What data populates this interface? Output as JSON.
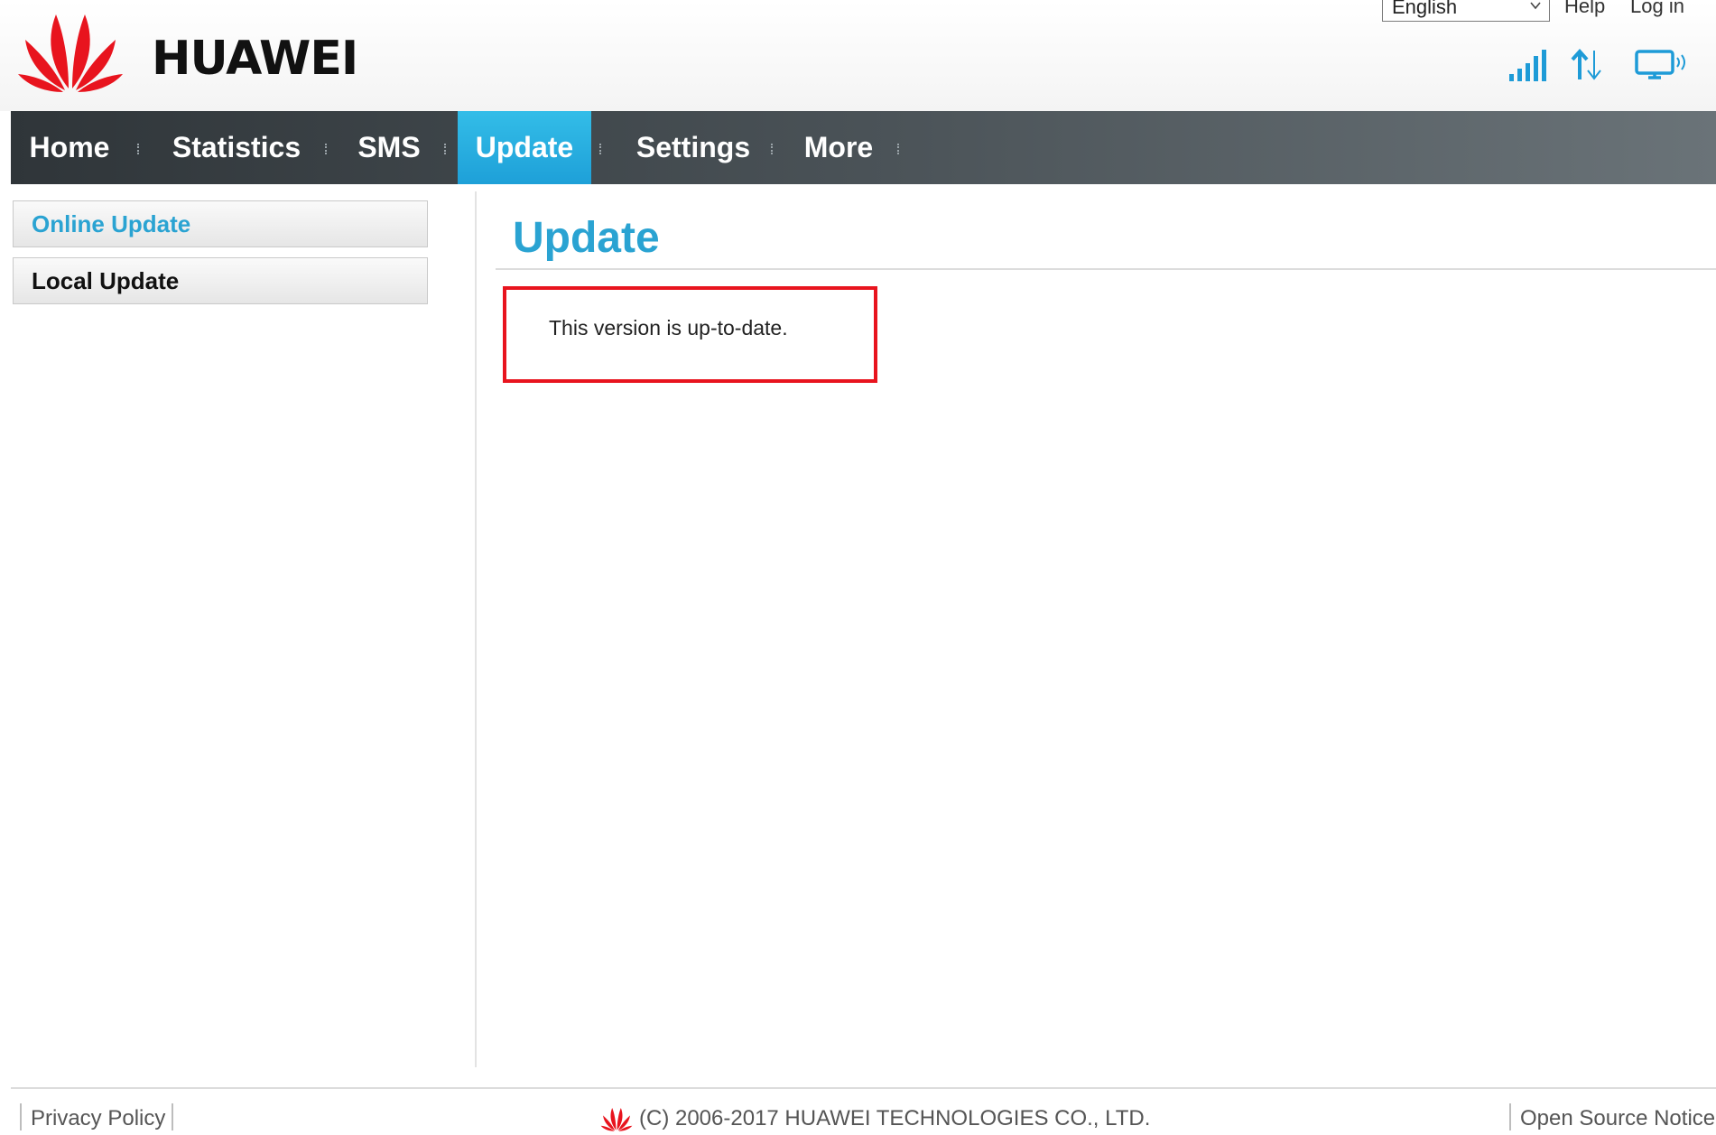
{
  "header": {
    "brand": "HUAWEI",
    "language": "English",
    "help_label": "Help",
    "login_label": "Log in",
    "icons": [
      "signal-icon",
      "data-transfer-icon",
      "wifi-device-icon"
    ],
    "accent_color": "#2aa3d2",
    "brand_color": "#e8141e"
  },
  "nav": {
    "items": [
      {
        "label": "Home"
      },
      {
        "label": "Statistics"
      },
      {
        "label": "SMS"
      },
      {
        "label": "Update",
        "active": true
      },
      {
        "label": "Settings"
      },
      {
        "label": "More"
      }
    ]
  },
  "sidebar": {
    "items": [
      {
        "label": "Online Update",
        "selected": true
      },
      {
        "label": "Local Update"
      }
    ]
  },
  "main": {
    "title": "Update",
    "status_message": "This version is up-to-date."
  },
  "footer": {
    "privacy_label": "Privacy Policy",
    "copyright": "(C) 2006-2017 HUAWEI TECHNOLOGIES CO., LTD.",
    "open_source_label": "Open Source Notice"
  }
}
